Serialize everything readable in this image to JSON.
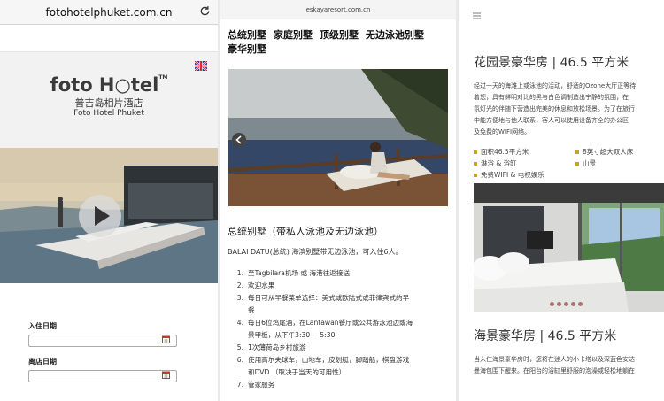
{
  "panel1": {
    "url": "fotohotelphuket.com.cn",
    "logo_text": "foto H○tel",
    "logo_tm": "TM",
    "subtitle_cn": "普吉岛相片酒店",
    "subtitle_en": "Foto Hotel Phuket",
    "checkin_label": "入住日期",
    "checkout_label": "离店日期",
    "checkin_value": "",
    "checkout_value": ""
  },
  "panel2": {
    "url": "eskayaresort.com.cn",
    "nav": [
      "总统别墅",
      "家庭别墅",
      "顶级别墅",
      "无边泳池别墅",
      "豪华别墅"
    ],
    "section_title": "总统别墅（带私人泳池及无边泳池）",
    "intro": "BALAI DATU(总统) 海滨别墅带无边泳池，可入住6人。",
    "list": [
      {
        "n": "1.",
        "text": "至Tagbilara机场 或 海港往返接送"
      },
      {
        "n": "2.",
        "text": "欢迎水果"
      },
      {
        "n": "3.",
        "text": "每日可从早餐菜单选择：美式或欧陆式或菲律宾式的早"
      },
      {
        "n": "",
        "text": "餐"
      },
      {
        "n": "4.",
        "text": "每日6位鸡尾酒，在Lantawan餐厅或公共游泳池边或海"
      },
      {
        "n": "",
        "text": "景甲板，从下午3:30 ~ 5:30"
      },
      {
        "n": "5.",
        "text": "1次薄荷岛乡村旅游"
      },
      {
        "n": "6.",
        "text": "使用高尔夫球车，山地车，皮划艇，脚踏船，棋盘游戏"
      },
      {
        "n": "",
        "text": "和DVD （取决于当天的可用性）"
      },
      {
        "n": "7.",
        "text": "管家服务"
      }
    ]
  },
  "panel3": {
    "room1_title": "花园景豪华房 | 46.5 平方米",
    "room1_desc": [
      "经过一天的海滩上或泳池的活动，舒适的Ozone大厅正等待",
      "着您，具有鲜明对比的黑与白色调制造出宁静的氛围，在",
      "氛灯光的伴随下营造出完美的休息和放松场景。为了在旅行",
      "中能方便地与他人联系，客人可以使用设备齐全的办公区",
      "及免费的WIFI网络。"
    ],
    "features": [
      "面积46.5平方米",
      "8英寸超大双人床",
      "淋浴 & 浴缸",
      "山景",
      "免费WIFI & 电视娱乐"
    ],
    "room2_title": "海景豪华房 | 46.5 平方米",
    "room2_desc": [
      "当入住海景豪华房时，您将在迷人的小卡塔以及深蓝色安达",
      "曼海包围下醒来。在阳台的浴缸里舒服的泡澡或轻松地躺在"
    ]
  },
  "colors": {
    "accent_gold": "#c9a227",
    "slider_dot": "#9b4b4b",
    "calendar_red": "#c0392b"
  }
}
